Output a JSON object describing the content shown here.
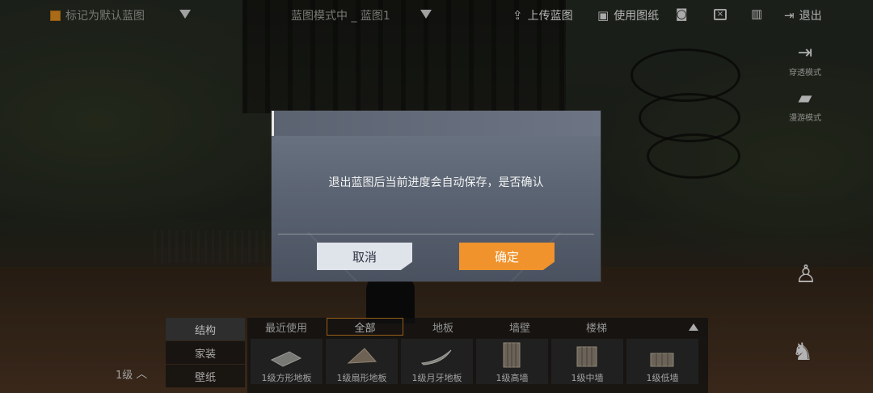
{
  "topbar": {
    "mark_default_label": "标记为默认蓝图",
    "blueprint_mode_title": "蓝图模式中 _ 蓝图1",
    "upload_label": "上传蓝图",
    "use_drawing_label": "使用图纸",
    "exit_label": "退出"
  },
  "side": {
    "pass_mode_label": "穿透模式",
    "roam_mode_label": "漫游模式"
  },
  "dialog": {
    "message": "退出蓝图后当前进度会自动保存，是否确认",
    "cancel_label": "取消",
    "confirm_label": "确定"
  },
  "panel": {
    "level_label": "1级",
    "categories": [
      "结构",
      "家装",
      "壁纸"
    ],
    "tabs": [
      "最近使用",
      "全部",
      "地板",
      "墙壁",
      "楼梯"
    ],
    "items": [
      "1级方形地板",
      "1级扇形地板",
      "1级月牙地板",
      "1级高墙",
      "1级中墙",
      "1级低墙"
    ]
  },
  "colors": {
    "accent": "#f0932d",
    "checkbox": "#d98a1f"
  },
  "icons": [
    "chevron-down-icon",
    "upload-icon",
    "drawing-icon",
    "camera-icon",
    "delete-x-icon",
    "trash-icon",
    "exit-icon",
    "pass-mode-icon",
    "roam-mode-icon",
    "crouch-icon",
    "prone-icon",
    "chevron-up-icon"
  ]
}
